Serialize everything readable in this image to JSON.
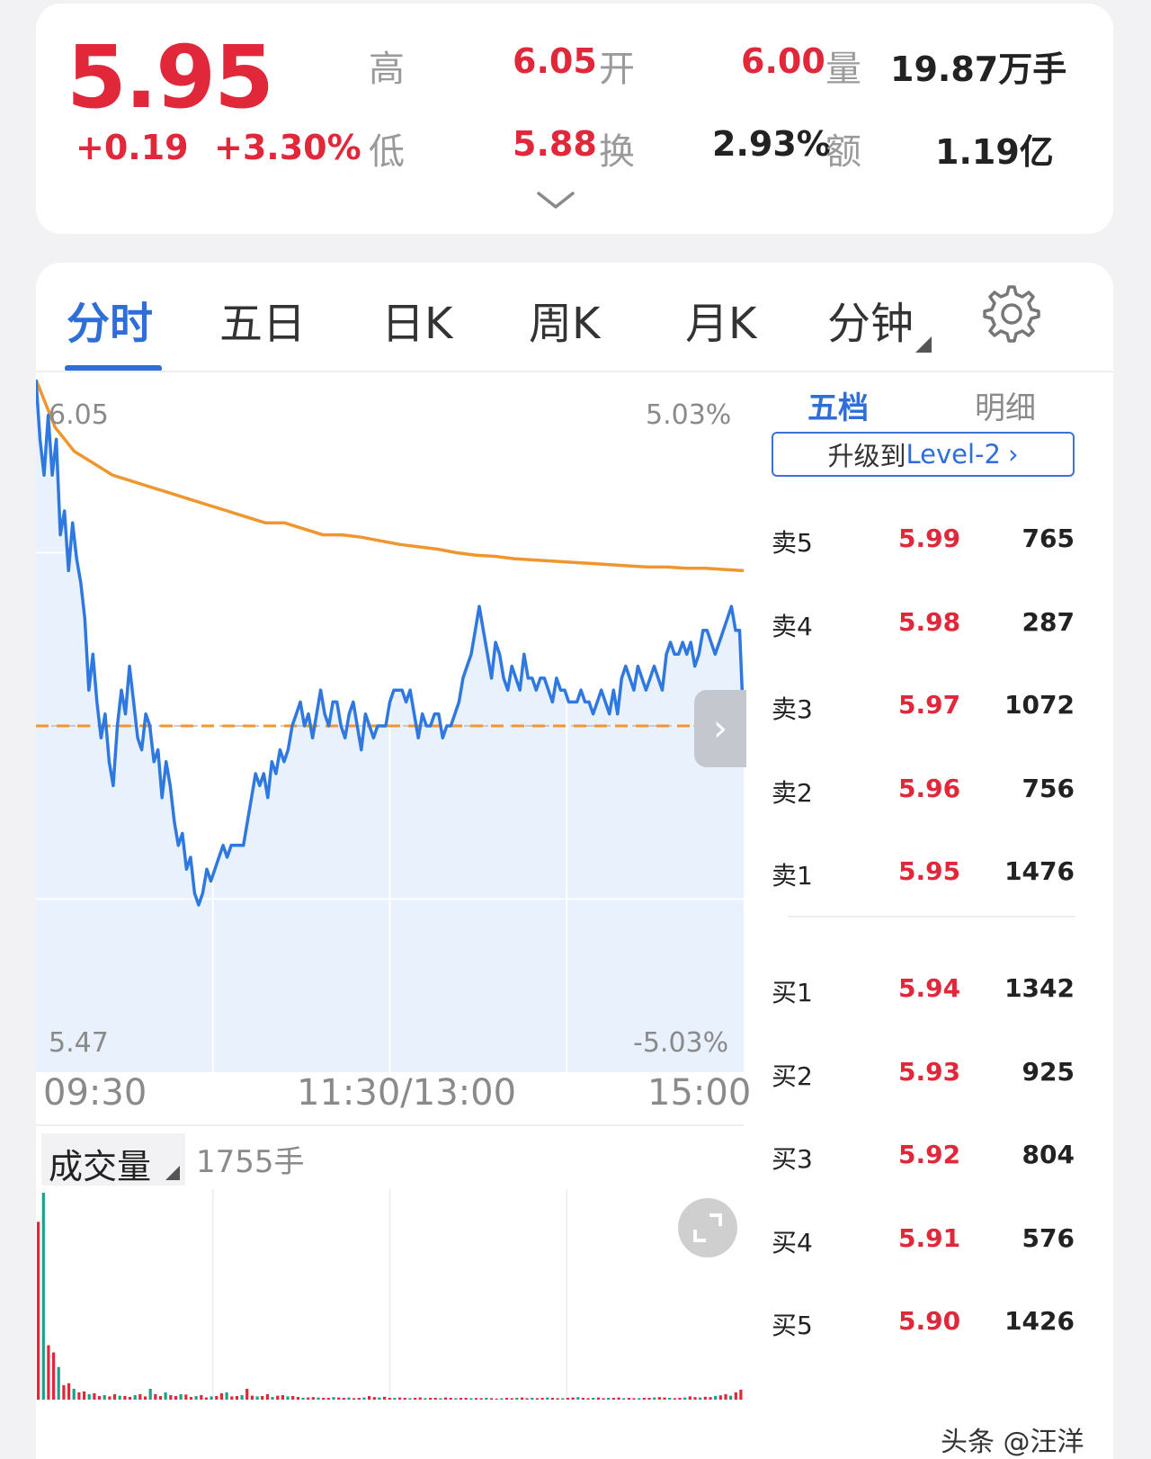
{
  "quote": {
    "price": "5.95",
    "change": "+0.19",
    "change_pct": "+3.30%",
    "high_label": "高",
    "high_value": "6.05",
    "open_label": "开",
    "open_value": "6.00",
    "volume_label": "量",
    "volume_value": "19.87万手",
    "low_label": "低",
    "low_value": "5.88",
    "turnover_label": "换",
    "turnover_value": "2.93%",
    "amount_label": "额",
    "amount_value": "1.19亿"
  },
  "tabs": [
    "分时",
    "五日",
    "日K",
    "周K",
    "月K",
    "分钟"
  ],
  "active_tab": 0,
  "side_tabs": {
    "five_levels": "五档",
    "details": "明细"
  },
  "level_button": {
    "prefix": "升级到 ",
    "highlight": "Level-2",
    "chevron": "›"
  },
  "order_book": {
    "asks": [
      {
        "label": "卖5",
        "price": "5.99",
        "volume": "765"
      },
      {
        "label": "卖4",
        "price": "5.98",
        "volume": "287"
      },
      {
        "label": "卖3",
        "price": "5.97",
        "volume": "1072"
      },
      {
        "label": "卖2",
        "price": "5.96",
        "volume": "756"
      },
      {
        "label": "卖1",
        "price": "5.95",
        "volume": "1476"
      }
    ],
    "bids": [
      {
        "label": "买1",
        "price": "5.94",
        "volume": "1342"
      },
      {
        "label": "买2",
        "price": "5.93",
        "volume": "925"
      },
      {
        "label": "买3",
        "price": "5.92",
        "volume": "804"
      },
      {
        "label": "买4",
        "price": "5.91",
        "volume": "576"
      },
      {
        "label": "买5",
        "price": "5.90",
        "volume": "1426"
      }
    ]
  },
  "chart_axis": {
    "price_max": "6.05",
    "price_min": "5.47",
    "pct_max": "5.03%",
    "pct_min": "-5.03%",
    "time_start": "09:30",
    "time_mid": "11:30/13:00",
    "time_end": "15:00"
  },
  "volume_panel": {
    "label": "成交量",
    "value": "1755手"
  },
  "watermark": "头条 @汪洋",
  "colors": {
    "up": "#e0283a",
    "accent": "#2f6ed8",
    "avg_line": "#f0962e",
    "price_line": "#2f78e0",
    "area_fill": "#e8f1fc",
    "vol_green": "#1aa38a"
  },
  "chart_data": {
    "type": "line",
    "x_range": [
      "09:30",
      "15:00"
    ],
    "ylim": [
      5.47,
      6.05
    ],
    "prev_close": 5.76,
    "series": [
      {
        "values": [
          6.05,
          6.0,
          5.97,
          6.02,
          5.97,
          6.0,
          5.92,
          5.94,
          5.89,
          5.93,
          5.9,
          5.88,
          5.85,
          5.79,
          5.82,
          5.78,
          5.75,
          5.77,
          5.73,
          5.71,
          5.76,
          5.79,
          5.77,
          5.81,
          5.78,
          5.75,
          5.74,
          5.77,
          5.76,
          5.73,
          5.74,
          5.7,
          5.73,
          5.71,
          5.68,
          5.66,
          5.67,
          5.64,
          5.65,
          5.62,
          5.61,
          5.62,
          5.64,
          5.63,
          5.64,
          5.65,
          5.66,
          5.65,
          5.66,
          5.66,
          5.66,
          5.66,
          5.68,
          5.7,
          5.72,
          5.71,
          5.72,
          5.7,
          5.73,
          5.72,
          5.74,
          5.73,
          5.74,
          5.76,
          5.77,
          5.78,
          5.76,
          5.77,
          5.75,
          5.77,
          5.79,
          5.77,
          5.76,
          5.78,
          5.78,
          5.76,
          5.75,
          5.77,
          5.78,
          5.76,
          5.74,
          5.77,
          5.76,
          5.75,
          5.76,
          5.76,
          5.76,
          5.78,
          5.79,
          5.79,
          5.79,
          5.78,
          5.79,
          5.77,
          5.75,
          5.77,
          5.76,
          5.76,
          5.77,
          5.77,
          5.75,
          5.76,
          5.76,
          5.77,
          5.78,
          5.8,
          5.81,
          5.82,
          5.84,
          5.86,
          5.84,
          5.82,
          5.8,
          5.83,
          5.82,
          5.8,
          5.79,
          5.81,
          5.8,
          5.79,
          5.82,
          5.8,
          5.8,
          5.79,
          5.8,
          5.8,
          5.79,
          5.78,
          5.8,
          5.79,
          5.79,
          5.78,
          5.78,
          5.78,
          5.79,
          5.78,
          5.78,
          5.77,
          5.78,
          5.79,
          5.78,
          5.77,
          5.79,
          5.77,
          5.8,
          5.81,
          5.8,
          5.79,
          5.81,
          5.8,
          5.79,
          5.8,
          5.81,
          5.8,
          5.79,
          5.82,
          5.83,
          5.82,
          5.82,
          5.83,
          5.82,
          5.83,
          5.81,
          5.82,
          5.84,
          5.84,
          5.83,
          5.82,
          5.83,
          5.84,
          5.85,
          5.86,
          5.84,
          5.84,
          5.76
        ]
      },
      {
        "values": [
          6.05,
          6.01,
          5.99,
          5.98,
          5.97,
          5.965,
          5.96,
          5.955,
          5.95,
          5.945,
          5.94,
          5.935,
          5.93,
          5.93,
          5.925,
          5.92,
          5.92,
          5.918,
          5.915,
          5.912,
          5.91,
          5.908,
          5.905,
          5.903,
          5.902,
          5.9,
          5.899,
          5.898,
          5.897,
          5.896,
          5.895,
          5.894,
          5.893,
          5.893,
          5.892,
          5.892,
          5.891,
          5.89
        ]
      }
    ],
    "volume": [
      980,
      1140,
      300,
      260,
      180,
      80,
      90,
      60,
      40,
      45,
      30,
      35,
      20,
      25,
      18,
      30,
      22,
      20,
      15,
      25,
      30,
      18,
      60,
      30,
      20,
      40,
      25,
      20,
      30,
      28,
      15,
      20,
      25,
      12,
      18,
      20,
      35,
      40,
      18,
      20,
      25,
      60,
      22,
      18,
      20,
      30,
      15,
      22,
      25,
      18,
      20,
      15,
      10,
      12,
      14,
      12,
      10,
      10,
      14,
      12,
      10,
      12,
      8,
      10,
      12,
      20,
      14,
      12,
      16,
      10,
      10,
      12,
      10,
      8,
      10,
      12,
      8,
      10,
      10,
      8,
      12,
      10,
      8,
      10,
      10,
      8,
      9,
      8,
      10,
      8,
      6,
      8,
      10,
      8,
      10,
      12,
      8,
      10,
      8,
      10,
      12,
      10,
      8,
      8,
      10,
      12,
      14,
      10,
      8,
      10,
      12,
      8,
      10,
      10,
      12,
      8,
      10,
      8,
      8,
      10,
      10,
      12,
      14,
      12,
      10,
      8,
      10,
      12,
      18,
      14,
      12,
      16,
      14,
      20,
      24,
      30,
      22,
      40,
      55
    ]
  }
}
